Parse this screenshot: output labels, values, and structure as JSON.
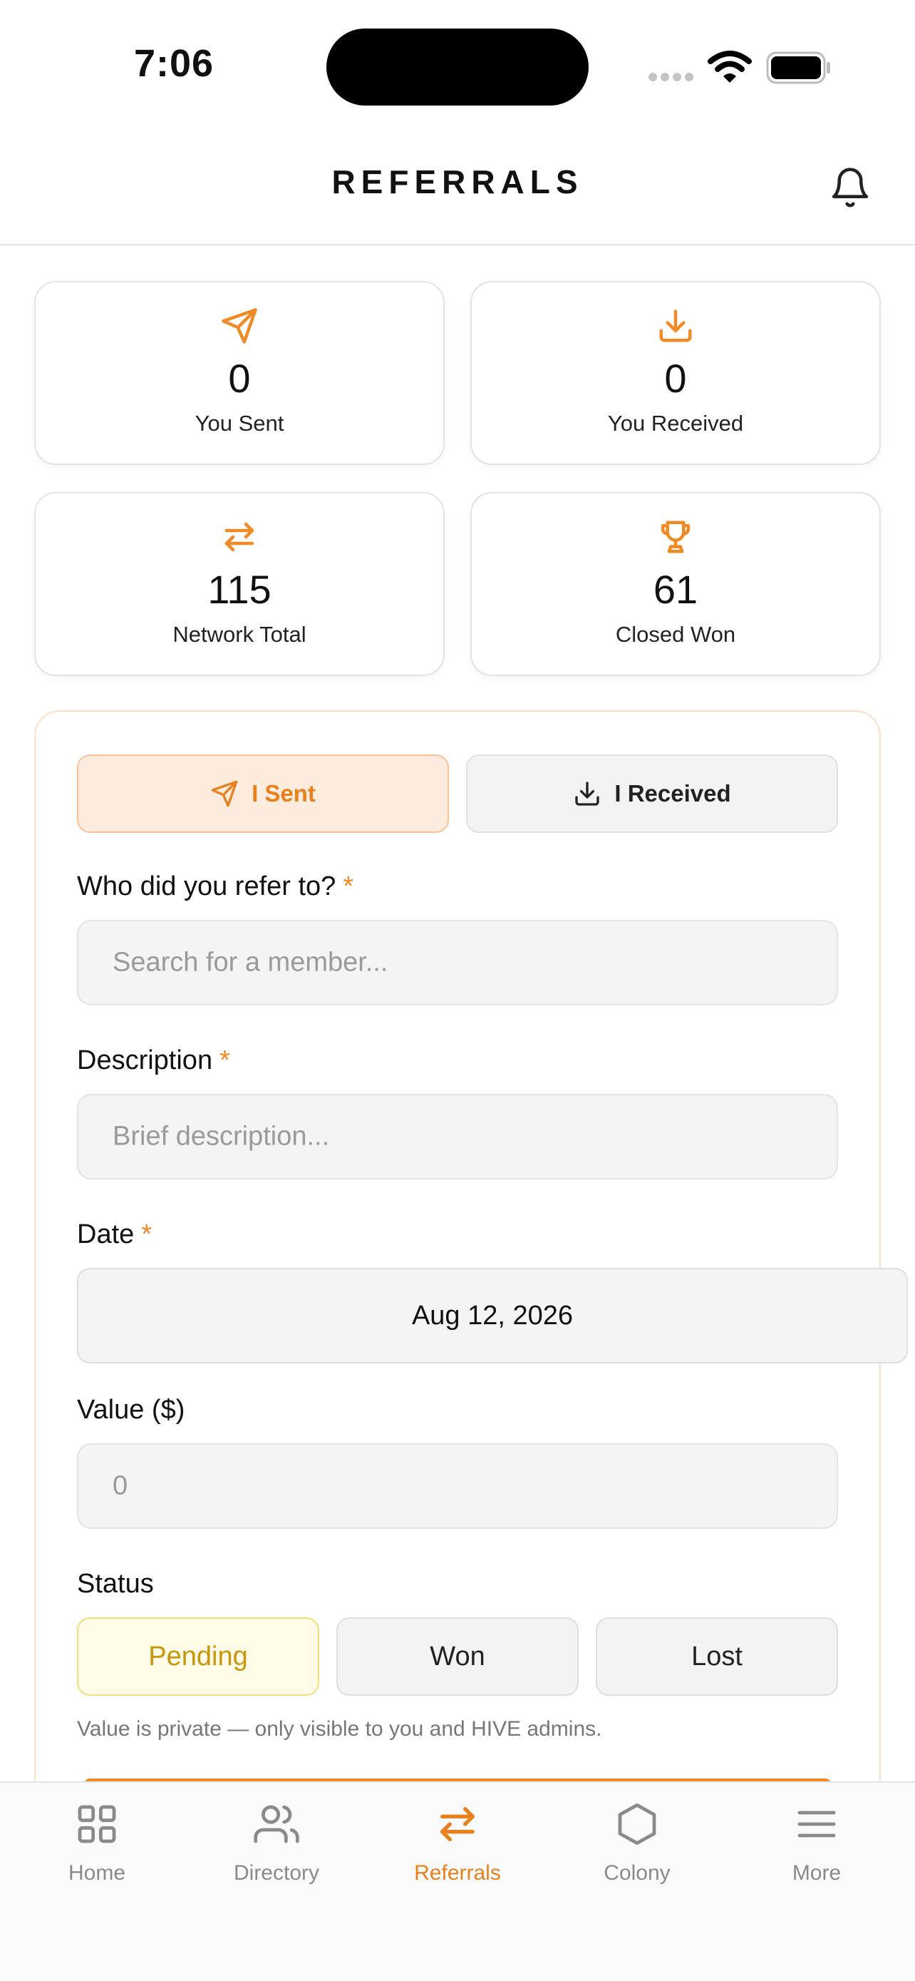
{
  "status_bar": {
    "time": "7:06"
  },
  "header": {
    "title": "REFERRALS",
    "bell_icon": "bell-icon"
  },
  "stats": [
    {
      "icon": "send-icon",
      "value": "0",
      "label": "You Sent"
    },
    {
      "icon": "download-icon",
      "value": "0",
      "label": "You Received"
    },
    {
      "icon": "arrows-swap-icon",
      "value": "115",
      "label": "Network Total"
    },
    {
      "icon": "trophy-icon",
      "value": "61",
      "label": "Closed Won"
    }
  ],
  "form": {
    "toggle": {
      "sent_label": "I Sent",
      "received_label": "I Received",
      "selected": "I Sent"
    },
    "refer_to": {
      "label": "Who did you refer to?",
      "required_mark": "*",
      "placeholder": "Search for a member..."
    },
    "description": {
      "label": "Description",
      "required_mark": "*",
      "placeholder": "Brief description..."
    },
    "date": {
      "label": "Date",
      "required_mark": "*",
      "value": "Aug 12, 2026"
    },
    "value": {
      "label": "Value ($)",
      "placeholder": "0"
    },
    "status": {
      "label": "Status",
      "options": [
        "Pending",
        "Won",
        "Lost"
      ],
      "selected": "Pending"
    },
    "privacy_note": "Value is private — only visible to you and HIVE admins."
  },
  "tabbar": {
    "items": [
      {
        "label": "Home",
        "icon": "grid-icon"
      },
      {
        "label": "Directory",
        "icon": "users-icon"
      },
      {
        "label": "Referrals",
        "icon": "arrows-swap-icon"
      },
      {
        "label": "Colony",
        "icon": "hexagon-icon"
      },
      {
        "label": "More",
        "icon": "menu-icon"
      }
    ],
    "active": "Referrals"
  },
  "colors": {
    "accent": "#f08a24",
    "accent_text": "#e8801e",
    "pending": "#c9960c"
  }
}
